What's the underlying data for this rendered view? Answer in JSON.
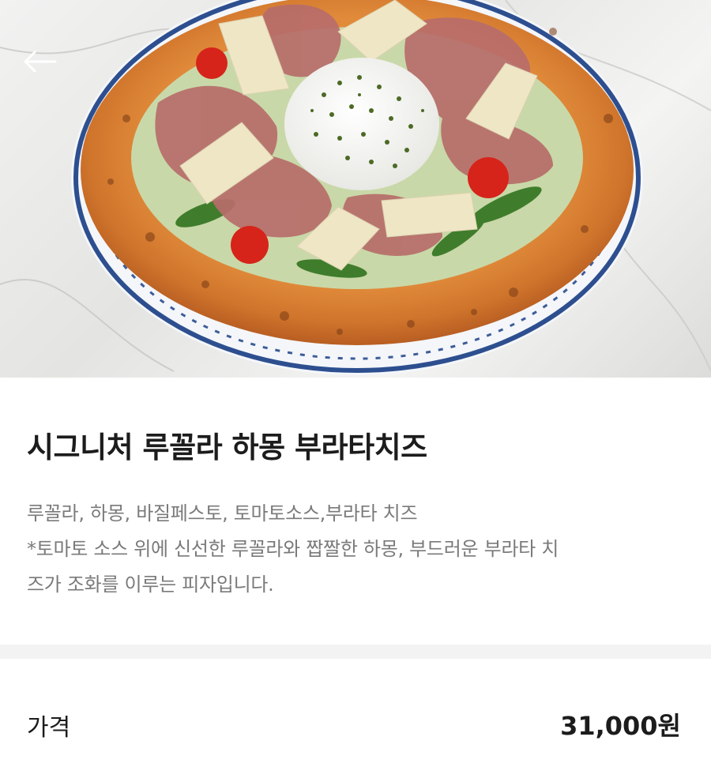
{
  "menu_item": {
    "title": "시그니처 루꼴라 하몽 부라타치즈",
    "description_lines": [
      "루꼴라, 하몽, 바질페스토, 토마토소스,부라타 치즈",
      "*토마토 소스 위에 신선한 루꼴라와 짭짤한 하몽, 부드러운 부라타 치",
      "즈가 조화를 이루는 피자입니다."
    ]
  },
  "price": {
    "label": "가격",
    "value": "31,000원"
  },
  "icons": {
    "back": "arrow-left-icon"
  },
  "colors": {
    "title_text": "#1c1c1c",
    "description_text": "#7a7a7a",
    "divider": "#f3f3f3"
  }
}
